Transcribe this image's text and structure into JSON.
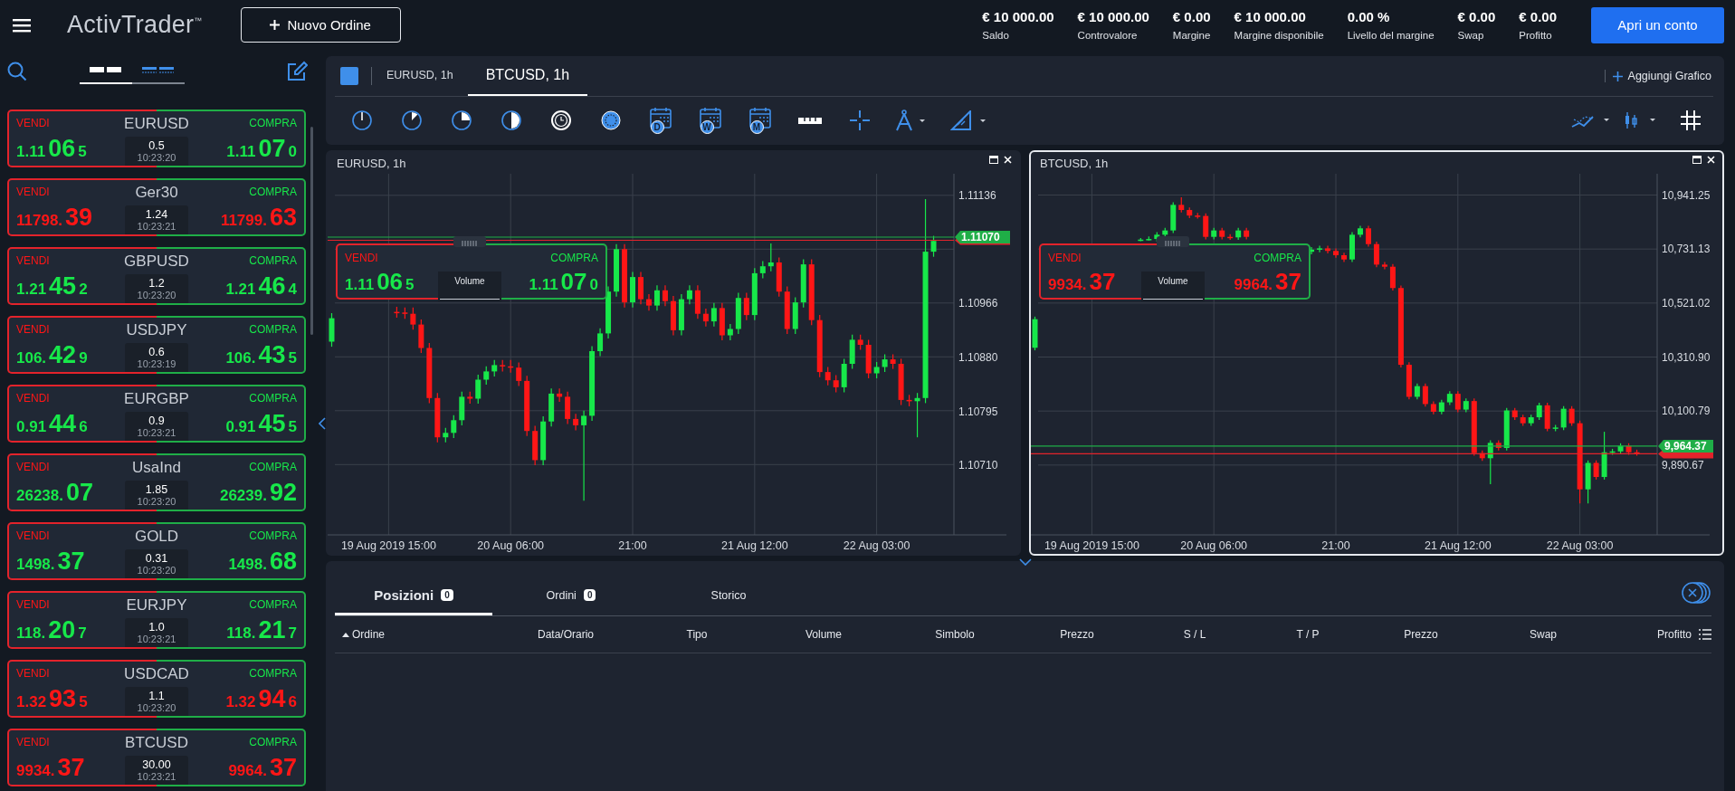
{
  "top_bar": {
    "logo": "ActivTrader$^{™}$",
    "new_order_button": "Nuovo Ordine",
    "stats": [
      {
        "value": "€ 10 000.00",
        "label": "Saldo"
      },
      {
        "value": "€ 10 000.00",
        "label": "Controvalore"
      },
      {
        "value": "€ 0.00",
        "label": "Margine"
      },
      {
        "value": "€ 10 000.00",
        "label": "Margine disponibile"
      },
      {
        "value": "0.00 %",
        "label": "Livello del margine"
      },
      {
        "value": "€ 0.00",
        "label": "Swap"
      },
      {
        "value": "€ 0.00",
        "label": "Profitto"
      }
    ],
    "open_account_button": "Apri un conto"
  },
  "watchlist": {
    "view_tabs": [
      {
        "selected": true
      },
      {
        "selected": false
      }
    ],
    "instruments": [
      {
        "symbol": "EURUSD",
        "sell_label": "VENDI",
        "buy_label": "COMPRA",
        "sell": [
          "1.11",
          "06",
          "5"
        ],
        "buy": [
          "1.11",
          "07",
          "0"
        ],
        "color": "#17e84a",
        "spread": "0.5",
        "time": "10:23:20"
      },
      {
        "symbol": "Ger30",
        "sell_label": "VENDI",
        "buy_label": "COMPRA",
        "sell": [
          "11798.",
          "39"
        ],
        "buy": [
          "11799.",
          "63"
        ],
        "color": "#ff1616",
        "spread": "1.24",
        "time": "10:23:21"
      },
      {
        "symbol": "GBPUSD",
        "sell_label": "VENDI",
        "buy_label": "COMPRA",
        "sell": [
          "1.21",
          "45",
          "2"
        ],
        "buy": [
          "1.21",
          "46",
          "4"
        ],
        "color": "#17e84a",
        "spread": "1.2",
        "time": "10:23:20"
      },
      {
        "symbol": "USDJPY",
        "sell_label": "VENDI",
        "buy_label": "COMPRA",
        "sell": [
          "106.",
          "42",
          "9"
        ],
        "buy": [
          "106.",
          "43",
          "5"
        ],
        "color": "#17e84a",
        "spread": "0.6",
        "time": "10:23:19"
      },
      {
        "symbol": "EURGBP",
        "sell_label": "VENDI",
        "buy_label": "COMPRA",
        "sell": [
          "0.91",
          "44",
          "6"
        ],
        "buy": [
          "0.91",
          "45",
          "5"
        ],
        "color": "#17e84a",
        "spread": "0.9",
        "time": "10:23:21"
      },
      {
        "symbol": "UsaInd",
        "sell_label": "VENDI",
        "buy_label": "COMPRA",
        "sell": [
          "26238.",
          "07"
        ],
        "buy": [
          "26239.",
          "92"
        ],
        "color": "#17e84a",
        "spread": "1.85",
        "time": "10:23:20"
      },
      {
        "symbol": "GOLD",
        "sell_label": "VENDI",
        "buy_label": "COMPRA",
        "sell": [
          "1498.",
          "37"
        ],
        "buy": [
          "1498.",
          "68"
        ],
        "color": "#17e84a",
        "spread": "0.31",
        "time": "10:23:20"
      },
      {
        "symbol": "EURJPY",
        "sell_label": "VENDI",
        "buy_label": "COMPRA",
        "sell": [
          "118.",
          "20",
          "7"
        ],
        "buy": [
          "118.",
          "21",
          "7"
        ],
        "color": "#17e84a",
        "spread": "1.0",
        "time": "10:23:21"
      },
      {
        "symbol": "USDCAD",
        "sell_label": "VENDI",
        "buy_label": "COMPRA",
        "sell": [
          "1.32",
          "93",
          "5"
        ],
        "buy": [
          "1.32",
          "94",
          "6"
        ],
        "color": "#ff1616",
        "spread": "1.1",
        "time": "10:23:20"
      },
      {
        "symbol": "BTCUSD",
        "sell_label": "VENDI",
        "buy_label": "COMPRA",
        "sell": [
          "9934.",
          "37"
        ],
        "buy": [
          "9964.",
          "37"
        ],
        "color": "#ff1616",
        "spread": "30.00",
        "time": "10:23:21"
      }
    ]
  },
  "chart_tabs": {
    "tabs": [
      {
        "label": "EURUSD, 1h",
        "selected": false
      },
      {
        "label": "BTCUSD, 1h",
        "selected": true
      }
    ],
    "add_chart": "Aggiungi Grafico"
  },
  "toolbar": {
    "calendar_letters": [
      "D",
      "W",
      "M"
    ]
  },
  "charts": [
    {
      "title": "EURUSD, 1h",
      "selected": false,
      "chart_data": {
        "type": "candlestick",
        "ylim": [
          1.106,
          1.1117
        ],
        "yticks": [
          {
            "value": 1.11136,
            "label": "1.11136"
          },
          {
            "value": 1.10966,
            "label": "1.10966"
          },
          {
            "value": 1.1088,
            "label": "1.10880"
          },
          {
            "value": 1.10795,
            "label": "1.10795"
          },
          {
            "value": 1.1071,
            "label": "1.10710"
          }
        ],
        "grid": true,
        "ref_lines": [
          {
            "axis": "y",
            "value": 1.1107,
            "label": "1.11070",
            "color": "#1fae47"
          },
          {
            "axis": "y",
            "value": 1.11065,
            "color": "#e3232b"
          }
        ],
        "categories": [
          null,
          null,
          null,
          null,
          null,
          null,
          null,
          "19 Aug 2019 15:00",
          null,
          null,
          null,
          null,
          null,
          null,
          null,
          null,
          null,
          null,
          null,
          null,
          null,
          null,
          "20 Aug 06:00",
          null,
          null,
          null,
          null,
          null,
          null,
          null,
          null,
          null,
          null,
          null,
          null,
          null,
          null,
          "21:00",
          null,
          null,
          null,
          null,
          null,
          null,
          null,
          null,
          null,
          null,
          null,
          null,
          null,
          null,
          "21 Aug 12:00",
          null,
          null,
          null,
          null,
          null,
          null,
          null,
          null,
          null,
          null,
          null,
          null,
          null,
          null,
          "22 Aug 03:00",
          null,
          null,
          null,
          null,
          null,
          null,
          null
        ],
        "ohlc": [
          [
            1.10905,
            1.1095,
            1.10897,
            1.10942
          ],
          null,
          null,
          null,
          null,
          null,
          null,
          null,
          [
            1.10952,
            1.1096,
            1.10943,
            1.10951
          ],
          [
            1.10951,
            1.10959,
            1.10941,
            1.10949
          ],
          [
            1.10949,
            1.10959,
            1.10924,
            1.10932
          ],
          [
            1.10932,
            1.1094,
            1.10887,
            1.10895
          ],
          [
            1.10895,
            1.10903,
            1.10808,
            1.10816
          ],
          [
            1.10816,
            1.10824,
            1.10746,
            1.10754
          ],
          [
            1.10754,
            1.10769,
            1.10746,
            1.10761
          ],
          [
            1.10761,
            1.10789,
            1.10753,
            1.10781
          ],
          [
            1.10781,
            1.10826,
            1.10773,
            1.10818
          ],
          [
            1.10818,
            1.10826,
            1.10807,
            1.10815
          ],
          [
            1.10815,
            1.10853,
            1.10807,
            1.10845
          ],
          [
            1.10845,
            1.10866,
            1.10837,
            1.10858
          ],
          [
            1.10858,
            1.10876,
            1.1085,
            1.10868
          ],
          [
            1.10868,
            1.10876,
            1.10858,
            1.10866
          ],
          [
            1.10866,
            1.10876,
            1.10856,
            1.10864
          ],
          [
            1.10864,
            1.10872,
            1.10835,
            1.10843
          ],
          [
            1.10843,
            1.10851,
            1.10756,
            1.10764
          ],
          [
            1.10764,
            1.10772,
            1.1071,
            1.10718
          ],
          [
            1.10718,
            1.10787,
            1.1071,
            1.10779
          ],
          [
            1.10779,
            1.10831,
            1.10771,
            1.10823
          ],
          [
            1.10823,
            1.10831,
            1.1081,
            1.10818
          ],
          [
            1.10818,
            1.10826,
            1.10775,
            1.10783
          ],
          [
            1.10783,
            1.10791,
            1.10765,
            1.10773
          ],
          [
            1.10773,
            1.10796,
            1.10654,
            1.10788
          ],
          [
            1.10788,
            1.10898,
            1.1078,
            1.1089
          ],
          [
            1.1089,
            1.10926,
            1.10882,
            1.10918
          ],
          [
            1.10918,
            1.10992,
            1.1091,
            1.10984
          ],
          [
            1.10984,
            1.11059,
            1.10976,
            1.11051
          ],
          [
            1.11051,
            1.11059,
            1.10959,
            1.10967
          ],
          [
            1.10967,
            1.11015,
            1.10959,
            1.11007
          ],
          [
            1.11007,
            1.11015,
            1.10964,
            1.10972
          ],
          [
            1.10972,
            1.1098,
            1.10954,
            1.10962
          ],
          [
            1.10962,
            1.10994,
            1.10954,
            1.10986
          ],
          [
            1.10986,
            1.10994,
            1.10961,
            1.10969
          ],
          [
            1.10969,
            1.10977,
            1.10915,
            1.10923
          ],
          [
            1.10923,
            1.1098,
            1.10915,
            1.10972
          ],
          [
            1.10972,
            1.10994,
            1.10964,
            1.10986
          ],
          [
            1.10986,
            1.10994,
            1.10941,
            1.10949
          ],
          [
            1.10949,
            1.10957,
            1.10929,
            1.10937
          ],
          [
            1.10937,
            1.10966,
            1.10929,
            1.10958
          ],
          [
            1.10958,
            1.10966,
            1.10907,
            1.10915
          ],
          [
            1.10915,
            1.10933,
            1.10907,
            1.10925
          ],
          [
            1.10925,
            1.10982,
            1.10917,
            1.10974
          ],
          [
            1.10974,
            1.10982,
            1.10939,
            1.10947
          ],
          [
            1.10947,
            1.11021,
            1.10939,
            1.11013
          ],
          [
            1.11013,
            1.11032,
            1.11005,
            1.11024
          ],
          [
            1.11024,
            1.1106,
            1.11016,
            1.1103
          ],
          [
            1.1103,
            1.11038,
            1.10976,
            1.10984
          ],
          [
            1.10984,
            1.10992,
            1.10917,
            1.10925
          ],
          [
            1.10925,
            1.10975,
            1.10917,
            1.10967
          ],
          [
            1.10967,
            1.11035,
            1.10959,
            1.11027
          ],
          [
            1.11027,
            1.11035,
            1.10931,
            1.10939
          ],
          [
            1.10939,
            1.10947,
            1.10849,
            1.10857
          ],
          [
            1.10857,
            1.10865,
            1.10836,
            1.10844
          ],
          [
            1.10844,
            1.10852,
            1.10825,
            1.10833
          ],
          [
            1.10833,
            1.10878,
            1.10825,
            1.1087
          ],
          [
            1.1087,
            1.10916,
            1.10862,
            1.10908
          ],
          [
            1.10908,
            1.10916,
            1.10892,
            1.109
          ],
          [
            1.109,
            1.10908,
            1.10847,
            1.10855
          ],
          [
            1.10855,
            1.10873,
            1.10847,
            1.10865
          ],
          [
            1.10865,
            1.10885,
            1.10857,
            1.10877
          ],
          [
            1.10877,
            1.10885,
            1.10862,
            1.1087
          ],
          [
            1.1087,
            1.10878,
            1.10805,
            1.10813
          ],
          [
            1.10813,
            1.10821,
            1.10803,
            1.10811
          ],
          [
            1.10811,
            1.10824,
            1.10754,
            1.10816
          ],
          [
            1.10816,
            1.1113,
            1.10808,
            1.11047
          ],
          [
            1.11047,
            1.11072,
            1.11039,
            1.11064
          ]
        ]
      },
      "trade": {
        "sell_label": "VENDI",
        "buy_label": "COMPRA",
        "sell": [
          "1.11",
          "06",
          "5"
        ],
        "buy": [
          "1.11",
          "07",
          "0"
        ],
        "color": "#17e84a",
        "volume_label": "Volume"
      }
    },
    {
      "title": "BTCUSD, 1h",
      "selected": true,
      "chart_data": {
        "type": "candlestick",
        "ylim": [
          9618.93,
          11024.1
        ],
        "yticks": [
          {
            "value": 10941.25,
            "label": "10,941.25"
          },
          {
            "value": 10731.13,
            "label": "10,731.13"
          },
          {
            "value": 10521.02,
            "label": "10,521.02"
          },
          {
            "value": 10310.9,
            "label": "10,310.90"
          },
          {
            "value": 10100.79,
            "label": "10,100.79"
          },
          {
            "value": 9890.67,
            "label": "9,890.67"
          }
        ],
        "grid": true,
        "ref_lines": [
          {
            "axis": "y",
            "value": 9964.37,
            "label": "9,964.37",
            "color": "#1fae47"
          },
          {
            "axis": "y",
            "value": 9934.37,
            "color": "#e3232b"
          }
        ],
        "categories": [
          null,
          null,
          null,
          null,
          null,
          null,
          null,
          "19 Aug 2019 15:00",
          null,
          null,
          null,
          null,
          null,
          null,
          null,
          null,
          null,
          null,
          null,
          null,
          null,
          null,
          "20 Aug 06:00",
          null,
          null,
          null,
          null,
          null,
          null,
          null,
          null,
          null,
          null,
          null,
          null,
          null,
          null,
          "21:00",
          null,
          null,
          null,
          null,
          null,
          null,
          null,
          null,
          null,
          null,
          null,
          null,
          null,
          null,
          "21 Aug 12:00",
          null,
          null,
          null,
          null,
          null,
          null,
          null,
          null,
          null,
          null,
          null,
          null,
          null,
          null,
          "22 Aug 03:00",
          null,
          null,
          null,
          null,
          null,
          null,
          null
        ],
        "ohlc": [
          [
            10347.08,
            10468.28,
            10337.08,
            10458.28
          ],
          null,
          null,
          null,
          null,
          null,
          null,
          null,
          null,
          null,
          null,
          null,
          null,
          [
            10764,
            10774,
            10762,
            10768
          ],
          [
            10768,
            10780.3,
            10764,
            10770.3
          ],
          [
            10770.3,
            10796.9,
            10760.3,
            10786.9
          ],
          [
            10786.9,
            10813.5,
            10776.9,
            10803.5
          ],
          [
            10803.5,
            10913.08,
            10793.5,
            10903.08
          ],
          [
            10903.08,
            10932.95,
            10873.16,
            10883.16
          ],
          [
            10883.16,
            10893.16,
            10851.59,
            10861.59
          ],
          [
            10861.59,
            10871.59,
            10849.93,
            10859.93
          ],
          [
            10859.93,
            10869.93,
            10768.6,
            10778.6
          ],
          [
            10778.6,
            10813.5,
            10768.6,
            10803.5
          ],
          [
            10803.5,
            10813.5,
            10768.6,
            10778.6
          ],
          [
            10778.6,
            10788.6,
            10766.6,
            10776.6
          ],
          [
            10776.6,
            10813.5,
            10766.6,
            10803.5
          ],
          [
            10803.5,
            10813.5,
            10768.6,
            10778.6
          ],
          null,
          null,
          null,
          null,
          null,
          null,
          null,
          [
            10720.51,
            10738.81,
            10710.51,
            10728.81
          ],
          [
            10728.81,
            10743.79,
            10718.81,
            10733.79
          ],
          [
            10733.79,
            10743.79,
            10713.83,
            10723.83
          ],
          [
            10723.83,
            10733.83,
            10697.23,
            10707.23
          ],
          [
            10707.23,
            10717.23,
            10680.64,
            10690.64
          ],
          [
            10690.64,
            10796.9,
            10680.64,
            10786.9
          ],
          [
            10786.9,
            10821.8,
            10776.9,
            10811.8
          ],
          [
            10811.8,
            10821.8,
            10740.39,
            10750.39
          ],
          [
            10750.39,
            10760.39,
            10660.72,
            10670.72
          ],
          [
            10670.72,
            10680.72,
            10652.42,
            10662.42
          ],
          [
            10662.42,
            10672.42,
            10569.44,
            10579.44
          ],
          [
            10579.44,
            10589.44,
            10270.69,
            10280.69
          ],
          [
            10280.69,
            10290.69,
            10146.21,
            10156.21
          ],
          [
            10156.21,
            10207.71,
            10146.21,
            10197.71
          ],
          [
            10197.71,
            10207.71,
            10118,
            10128
          ],
          [
            10128,
            10138,
            10088.12,
            10098.12
          ],
          [
            10098.12,
            10144.64,
            10088.12,
            10134.64
          ],
          [
            10134.64,
            10177.83,
            10124.64,
            10167.83
          ],
          [
            10167.83,
            10177.83,
            10096.42,
            10106.42
          ],
          [
            10106.42,
            10149.62,
            10096.42,
            10139.62
          ],
          [
            10139.62,
            10149.62,
            9927.13,
            9937.13
          ],
          [
            9937.13,
            9947.13,
            9907.22,
            9917.22
          ],
          [
            9917.22,
            9986.97,
            9816,
            9976.97
          ],
          [
            9976.97,
            9986.97,
            9947.05,
            9957.05
          ],
          [
            9957.05,
            10113.1,
            9947.05,
            10103.1
          ],
          [
            10103.1,
            10113.1,
            10066.55,
            10076.55
          ],
          [
            10076.55,
            10086.55,
            10043.31,
            10053.31
          ],
          [
            10053.31,
            10086.55,
            10043.31,
            10076.55
          ],
          [
            10076.55,
            10133.02,
            10066.55,
            10123.02
          ],
          [
            10123.02,
            10133.02,
            10021.74,
            10031.74
          ],
          [
            10031.74,
            10046.72,
            10021.74,
            10036.72
          ],
          [
            10036.72,
            10119.74,
            10026.72,
            10109.74
          ],
          [
            10109.74,
            10119.74,
            10043.31,
            10053.31
          ],
          [
            10053.31,
            10063.31,
            9741.29,
            9796.06
          ],
          [
            9796.06,
            9908.96,
            9741.29,
            9898.96
          ],
          [
            9898.96,
            9908.96,
            9834.19,
            9844.19
          ],
          [
            9844.19,
            10020.1,
            9834.19,
            9940.45
          ],
          [
            9940.45,
            9953.77,
            9930.45,
            9943.77
          ],
          [
            9943.77,
            9975.35,
            9933.77,
            9965.35
          ],
          [
            9965.35,
            9975.35,
            9930.45,
            9940.45
          ],
          [
            9940.45,
            9950.45,
            9927.13,
            9937.13
          ]
        ]
      },
      "trade": {
        "sell_label": "VENDI",
        "buy_label": "COMPRA",
        "sell": [
          "9934.",
          "37"
        ],
        "buy": [
          "9964.",
          "37"
        ],
        "color": "#ff1616",
        "volume_label": "Volume"
      }
    }
  ],
  "positions": {
    "tabs": [
      {
        "label": "Posizioni",
        "count": "0",
        "selected": true
      },
      {
        "label": "Ordini",
        "count": "0",
        "selected": false
      },
      {
        "label": "Storico",
        "selected": false
      }
    ],
    "columns": [
      {
        "label": "Ordine",
        "sorted": true
      },
      {
        "label": "Data/Orario",
        "sorted": false
      },
      {
        "label": "Tipo",
        "sorted": false
      },
      {
        "label": "Volume",
        "sorted": false
      },
      {
        "label": "Simbolo",
        "sorted": false
      },
      {
        "label": "Prezzo",
        "sorted": false
      },
      {
        "label": "S / L",
        "sorted": false
      },
      {
        "label": "T / P",
        "sorted": false
      },
      {
        "label": "Prezzo",
        "sorted": false
      },
      {
        "label": "Swap",
        "sorted": false
      },
      {
        "label": "Profitto",
        "sorted": false
      }
    ]
  }
}
